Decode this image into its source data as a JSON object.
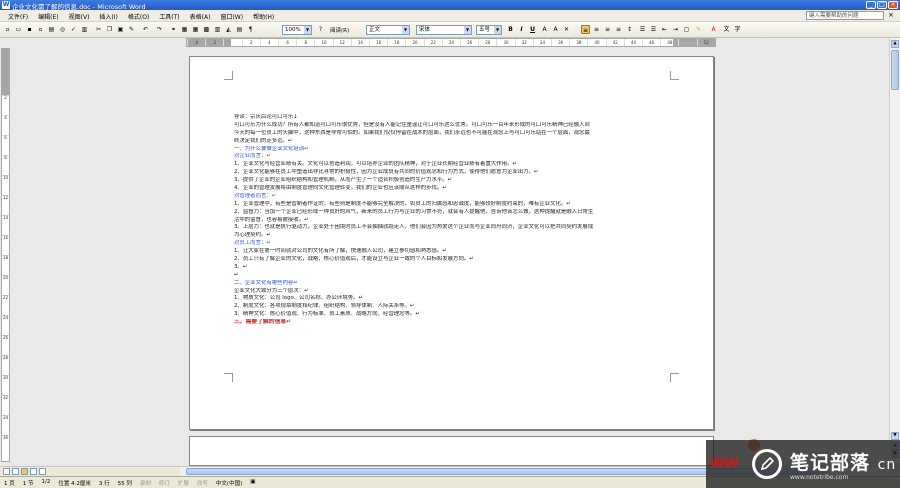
{
  "window": {
    "title": "企业文化需了解的信息.doc - Microsoft Word"
  },
  "menu": [
    "文件(F)",
    "编辑(E)",
    "视图(V)",
    "插入(I)",
    "格式(O)",
    "工具(T)",
    "表格(A)",
    "窗口(W)",
    "帮助(H)"
  ],
  "help": {
    "placeholder": "键入需要帮助的问题"
  },
  "toolbar": {
    "zoom": "100%",
    "reading": "阅读(R)",
    "style": "正文",
    "font": "宋体",
    "size": "五号",
    "bold": "B",
    "italic": "I",
    "underline": "U"
  },
  "document": {
    "lines": [
      {
        "text": "导读：宗庆后论可口可乐↓",
        "style": "normal"
      },
      {
        "text": "可口可乐为什么成功？所有人都知道可口可乐很优秀，但是没有人能记住童谣让可口可乐这么优秀。可口可乐一百年来形成的可口可乐精神已经融入到",
        "style": "normal"
      },
      {
        "text": "今天的每一位员工的头脑中，这种东西是非常可怕的。如果我们仅仅停留在战术的层面，我们永远也不可能在观念上与可口可乐站在一个层面，观念最",
        "style": "normal"
      },
      {
        "text": "终决定我们的走多远。↵",
        "style": "normal"
      },
      {
        "text": "一、为什么要做企业文化培训↵",
        "style": "h1"
      },
      {
        "text": "对企业而言：↵",
        "style": "h2"
      },
      {
        "text": "1、企业文化与经营业绩有关。文化可以创造利润，可以培养企业的团队精神，对于企业长期经营业绩有着重大作用。↵",
        "style": "normal"
      },
      {
        "text": "2、企业文化能够在员工中塑造出非比寻常的积极性，因为企业成员有共同的价值观念和行为方式，使得他们愿意为企业出力。↵",
        "style": "normal"
      },
      {
        "text": "3、提供了企业的企业组织结构和管理机制，从而产生了一个适合积极创造的生产力水平。↵",
        "style": "normal"
      },
      {
        "text": "4、企业的管理发展将由制度管理向文化管理转变，我们的企业也应该顺从这样的步伐。↵",
        "style": "normal"
      },
      {
        "text": "对管理者而言：↵",
        "style": "h2"
      },
      {
        "text": "1、企业管理中，有些是管制者作证的，有些则是制度不能够完全解决的，如员工的归属感和忠诚度，能够较好制度约束的，唯有企业文化。↵",
        "style": "normal"
      },
      {
        "text": "2、监督力：当加一个企业已经形成一种良好的风气，新来的员工行为与企业的习惯不符，就会有人提醒他，告诉他该怎么做，这种提醒就是融入日常生",
        "style": "normal"
      },
      {
        "text": "活中的监督，也容易被接收。↵",
        "style": "normal"
      },
      {
        "text": "3、上层力：也就是执行驱动力，企业处于困境时员工不会抽抽就跑走人，他们会因为热爱这个企业而与企业同舟同济，企业文化可以把共同契约发展成",
        "style": "normal"
      },
      {
        "text": "为心理契约。↵",
        "style": "normal"
      },
      {
        "text": "对员工而言：↵",
        "style": "h2"
      },
      {
        "text": "1、让大家在第一时间就对公司的文化有所了解，快速融入公司，建立参切感和熟悉感。↵",
        "style": "normal"
      },
      {
        "text": "2、员工只有了解企业的文化，战略，核心价值观后，才能设立与企业一致的个人目标和发展方向。↵",
        "style": "normal"
      },
      {
        "text": "3、↵",
        "style": "normal"
      },
      {
        "text": "↵",
        "style": "normal"
      },
      {
        "text": "二、企业文化有哪些内容↵",
        "style": "h1"
      },
      {
        "text": "企业文化大致分为三个层次：↵",
        "style": "normal"
      },
      {
        "text": "1、物质文化：公司 logo、公司名称、办公环境等。↵",
        "style": "normal"
      },
      {
        "text": "2、制度文化：各项规章制度和纪律、组织结构、领导体制、人际关系等。↵",
        "style": "normal"
      },
      {
        "text": "3、精神文化：核心价值观、行为标准、员工素质、战略方向、经营理念等。↵",
        "style": "normal"
      },
      {
        "text": "三、需要了解的信息↵",
        "style": "h3"
      }
    ]
  },
  "status": {
    "page": "1 页",
    "section": "1 节",
    "pages": "1/2",
    "position": "位置 4.2厘米",
    "line": "3 行",
    "column": "55 列",
    "rec": "录制",
    "trk": "修订",
    "ext": "扩展",
    "ovr": "改写",
    "language": "中文(中国)"
  },
  "watermark": {
    "title": "笔记部落",
    "tld": "cn",
    "url": "www.notetribe.com",
    "red": "WW"
  },
  "colors": {
    "heading": "#2a4fbf",
    "red_heading": "#d41d1d",
    "titlebar": "#2459c5"
  }
}
